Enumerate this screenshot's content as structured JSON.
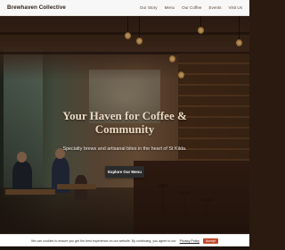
{
  "nav": {
    "brand": "Brewhaven Collective",
    "links": [
      "Our Story",
      "Menu",
      "Our Coffee",
      "Events",
      "Visit Us"
    ]
  },
  "hero": {
    "title_line1": "Your Haven for Coffee &",
    "title_line2": "Community",
    "subtitle": "Specialty brews and artisanal bites in the heart of St Kilda.",
    "cta_label": "Explore Our Menu"
  },
  "cookie": {
    "text": "We use cookies to ensure you get the best experience on our website. By continuing, you agree to our",
    "link_label": "Privacy Policy",
    "accept_label": "Accept"
  }
}
